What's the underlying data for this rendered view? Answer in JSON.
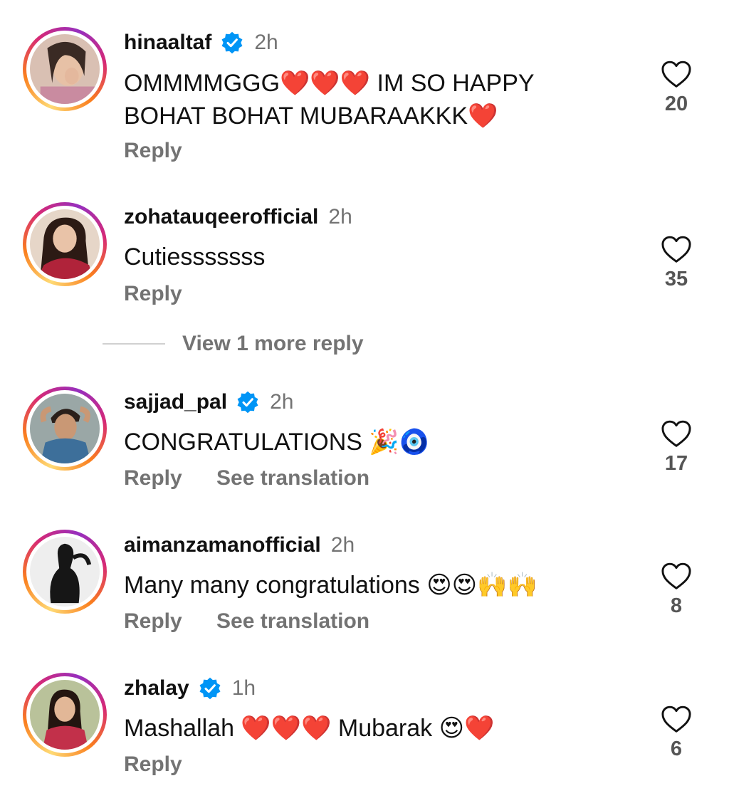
{
  "comments": [
    {
      "username": "hinaaltaf",
      "verified": true,
      "time": "2h",
      "text_lines": [
        "OMMMMGGG❤️❤️❤️ IM SO HAPPY",
        "BOHAT BOHAT MUBARAAKKK❤️"
      ],
      "reply_label": "Reply",
      "likes": "20"
    },
    {
      "username": "zohatauqeerofficial",
      "verified": false,
      "time": "2h",
      "text_lines": [
        "Cutiesssssss"
      ],
      "reply_label": "Reply",
      "likes": "35"
    },
    {
      "username": "sajjad_pal",
      "verified": true,
      "time": "2h",
      "text_lines": [
        "CONGRATULATIONS 🎉🧿"
      ],
      "reply_label": "Reply",
      "translate_label": "See translation",
      "likes": "17"
    },
    {
      "username": "aimanzamanofficial",
      "verified": false,
      "time": "2h",
      "text_lines": [
        "Many many congratulations 😍😍🙌🙌"
      ],
      "reply_label": "Reply",
      "translate_label": "See translation",
      "likes": "8"
    },
    {
      "username": "zhalay",
      "verified": true,
      "time": "1h",
      "text_lines": [
        "Mashallah ❤️❤️❤️ Mubarak 😍❤️"
      ],
      "reply_label": "Reply",
      "likes": "6"
    }
  ],
  "view_more_replies": "View 1 more reply",
  "colors": {
    "verified_blue": "#0095f6",
    "secondary_text": "#737373",
    "ring_gradient": [
      "#feda75",
      "#fa7e1e",
      "#d62976",
      "#962fbf"
    ]
  },
  "icons": {
    "like": "heart-outline-icon",
    "verified": "verified-badge-icon"
  }
}
